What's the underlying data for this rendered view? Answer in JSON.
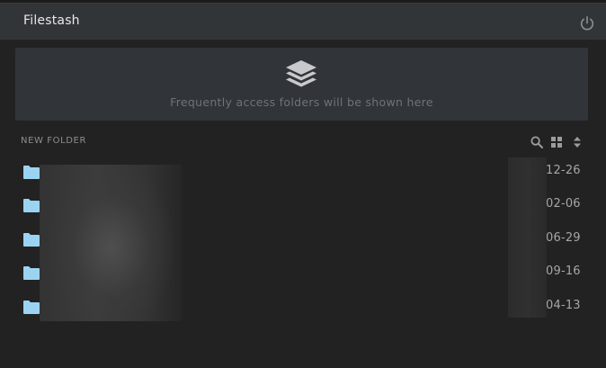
{
  "app": {
    "title": "Filestash"
  },
  "colors": {
    "folder": "#9bd4f2",
    "topbar": "#323538",
    "banner": "#313438"
  },
  "banner": {
    "text": "Frequently access folders will be shown here",
    "icon": "layers-icon"
  },
  "toolbar": {
    "new_folder_label": "NEW FOLDER",
    "icons": [
      "search-icon",
      "grid-view-icon",
      "sort-icon"
    ]
  },
  "files": [
    {
      "name": "",
      "date": "12-26",
      "type": "folder"
    },
    {
      "name": "",
      "date": "02-06",
      "type": "folder"
    },
    {
      "name": "",
      "date": "06-29",
      "type": "folder"
    },
    {
      "name": "",
      "date": "09-16",
      "type": "folder"
    },
    {
      "name": "",
      "date": "04-13",
      "type": "folder"
    }
  ]
}
